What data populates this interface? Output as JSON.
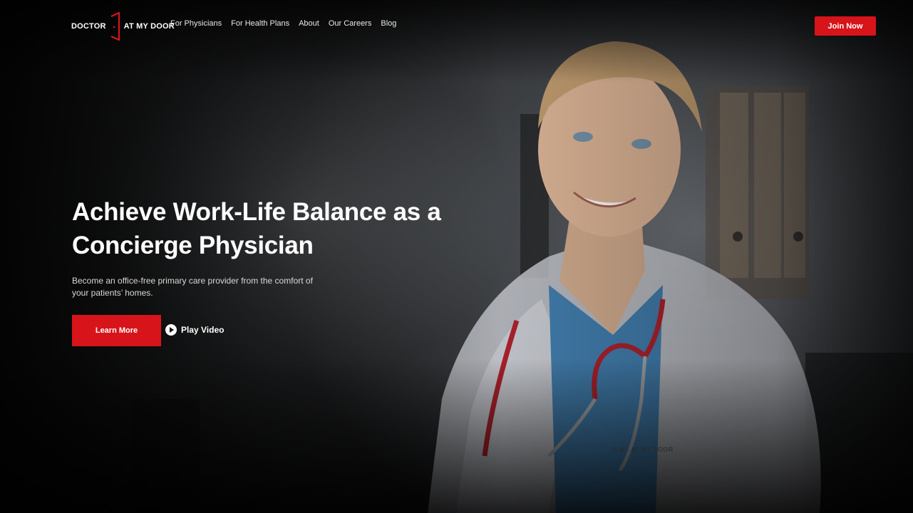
{
  "brand": {
    "logo_left": "DOCTOR",
    "logo_right": "AT MY DOOR",
    "accent_color": "#d7141a"
  },
  "nav": {
    "items": [
      {
        "label": "For Physicians"
      },
      {
        "label": "For Health Plans"
      },
      {
        "label": "About"
      },
      {
        "label": "Our Careers"
      },
      {
        "label": "Blog"
      }
    ],
    "cta_label": "Join Now"
  },
  "hero": {
    "headline_line1": "Achieve Work-Life Balance as a",
    "headline_line2": "Concierge Physician",
    "subtext_line1": "Become an office-free primary care provider from the comfort of",
    "subtext_line2": "your patients’ homes.",
    "primary_cta": "Learn More",
    "video_label": "Play Video",
    "coat_logo_text": "C  R · AT MY DOOR"
  },
  "icons": {
    "logo_mark": "door-bracket-icon",
    "play": "play-circle-icon"
  }
}
